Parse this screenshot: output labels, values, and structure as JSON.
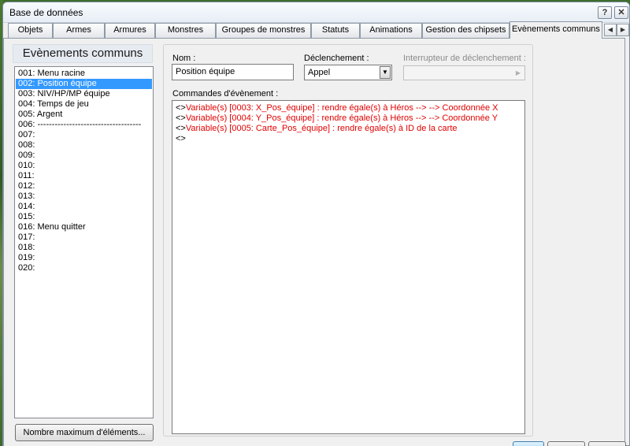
{
  "window": {
    "title": "Base de données",
    "help_icon": "?",
    "close_icon": "✕"
  },
  "tabs": [
    {
      "label": "Objets"
    },
    {
      "label": "Armes"
    },
    {
      "label": "Armures"
    },
    {
      "label": "Monstres"
    },
    {
      "label": "Groupes de monstres"
    },
    {
      "label": "Statuts"
    },
    {
      "label": "Animations"
    },
    {
      "label": "Gestion des chipsets"
    },
    {
      "label": "Evènements communs",
      "active": true
    }
  ],
  "tab_scroll": {
    "left": "◀",
    "right": "▶"
  },
  "sidebar": {
    "title": "Evènements communs",
    "items": [
      "001: Menu racine",
      "002: Position équipe",
      "003: NIV/HP/MP équipe",
      "004: Temps de jeu",
      "005: Argent",
      "006: ------------------------------------",
      "007:",
      "008:",
      "009:",
      "010:",
      "011:",
      "012:",
      "013:",
      "014:",
      "015:",
      "016: Menu quitter",
      "017:",
      "018:",
      "019:",
      "020:"
    ],
    "selected_index": 1,
    "max_button": "Nombre maximum d'éléments..."
  },
  "form": {
    "name_label": "Nom :",
    "name_value": "Position équipe",
    "trigger_label": "Déclenchement :",
    "trigger_value": "Appel",
    "trigger_arrow": "▼",
    "switch_label": "Interrupteur de déclenchement :",
    "switch_arrow": "▶",
    "commands_label": "Commandes d'évènement :",
    "commands": [
      {
        "prefix": "<>",
        "text": "Variable(s) [0003: X_Pos_équipe] : rendre égale(s) à Héros --> --> Coordonnée X"
      },
      {
        "prefix": "<>",
        "text": "Variable(s) [0004: Y_Pos_équipe] : rendre égale(s) à Héros --> --> Coordonnée Y"
      },
      {
        "prefix": "<>",
        "text": "Variable(s) [0005: Carte_Pos_équipe] : rendre égale(s) à ID de la carte"
      },
      {
        "prefix": "<>",
        "text": ""
      }
    ]
  },
  "colors": {
    "selection": "#3399ff",
    "command_text": "#e00000"
  }
}
